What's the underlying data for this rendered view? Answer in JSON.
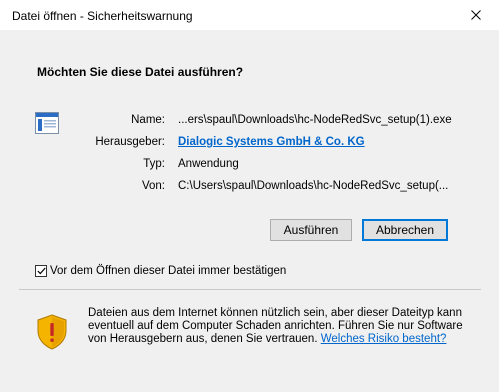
{
  "window": {
    "title": "Datei öffnen - Sicherheitswarnung"
  },
  "dialog": {
    "heading": "Möchten Sie diese Datei ausführen?",
    "fields": {
      "name_label": "Name:",
      "name_value": "...ers\\spaul\\Downloads\\hc-NodeRedSvc_setup(1).exe",
      "publisher_label": "Herausgeber:",
      "publisher_value": "Dialogic Systems GmbH & Co. KG",
      "type_label": "Typ:",
      "type_value": "Anwendung",
      "from_label": "Von:",
      "from_value": "C:\\Users\\spaul\\Downloads\\hc-NodeRedSvc_setup(..."
    },
    "buttons": {
      "run": "Ausführen",
      "cancel": "Abbrechen"
    },
    "checkbox": {
      "label": "Vor dem Öffnen dieser Datei immer bestätigen",
      "checked": true
    },
    "warning": {
      "text": "Dateien aus dem Internet können nützlich sein, aber dieser Dateityp kann eventuell auf dem Computer Schaden anrichten. Führen Sie nur Software von Herausgebern aus, denen Sie vertrauen.",
      "link": "Welches Risiko besteht?"
    }
  },
  "colors": {
    "link": "#0066cc",
    "focus_border": "#0078d7",
    "dialog_bg": "#f0f0f0"
  }
}
